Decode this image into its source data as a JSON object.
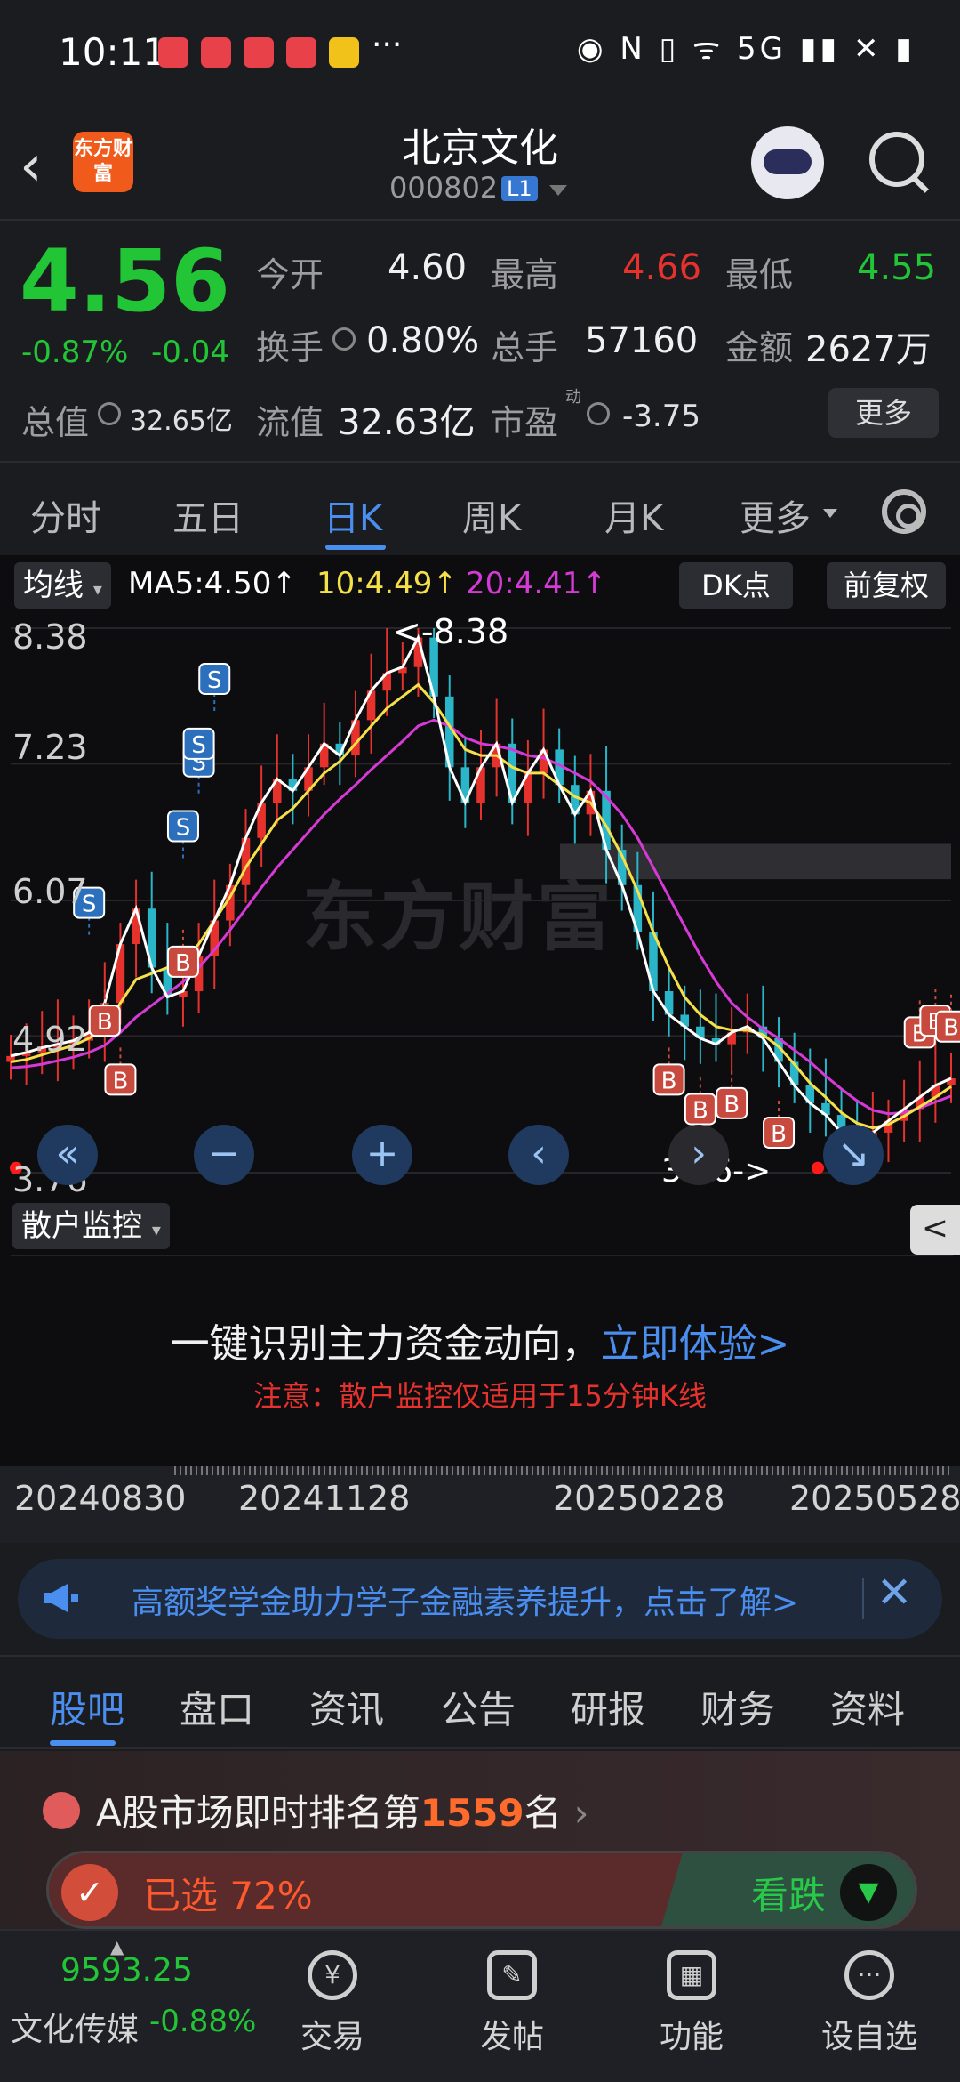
{
  "status": {
    "time": "10:11",
    "more": "···",
    "icons": "◉ N ▯ ᯤ 5G ▮▮ ✕ ▮"
  },
  "header": {
    "title": "北京文化",
    "code": "000802",
    "board_badge": "L1",
    "logo_text": "东方财富"
  },
  "quote": {
    "price": "4.56",
    "change_pct": "-0.87%",
    "change": "-0.04",
    "open_label": "今开",
    "open": "4.60",
    "high_label": "最高",
    "high": "4.66",
    "low_label": "最低",
    "low": "4.55",
    "turnover_label": "换手",
    "turnover": "0.80%",
    "volume_label": "总手",
    "volume": "57160",
    "amount_label": "金额",
    "amount": "2627万",
    "mktcap_label": "总值",
    "mktcap": "32.65亿",
    "float_label": "流值",
    "float_val": "32.63亿",
    "pe_label": "市盈",
    "pe_sup": "动",
    "pe": "-3.75",
    "more": "更多"
  },
  "ktabs": [
    "分时",
    "五日",
    "日K",
    "周K",
    "月K",
    "更多"
  ],
  "chart_toolbar": {
    "ma_label": "均线",
    "ma5": "MA5:4.50↑",
    "ma10": "10:4.49↑",
    "ma20": "20:4.41↑",
    "dk": "DK点",
    "adjust": "前复权"
  },
  "chart_labels": {
    "max_note": "<-8.38",
    "min_note": "3.76->",
    "watermark": "东方财富"
  },
  "chart_data": {
    "type": "candlestick",
    "y_ticks": [
      "8.38",
      "7.23",
      "6.07",
      "4.92",
      "3.76"
    ],
    "ylim": [
      3.76,
      8.38
    ],
    "x_ticks": [
      "20240830",
      "20241128",
      "20250228",
      "20250528"
    ],
    "max": 8.38,
    "min": 3.76,
    "series": [
      {
        "name": "MA5",
        "color": "#ffffff"
      },
      {
        "name": "MA10",
        "color": "#f5e04a"
      },
      {
        "name": "MA20",
        "color": "#d63ad6"
      }
    ],
    "close_path": [
      4.75,
      4.78,
      4.82,
      4.85,
      4.88,
      4.95,
      5.2,
      5.7,
      6.0,
      5.5,
      5.25,
      5.3,
      5.6,
      5.9,
      6.2,
      6.6,
      6.9,
      7.1,
      7.0,
      7.2,
      7.4,
      7.3,
      7.6,
      7.85,
      8.0,
      8.05,
      8.3,
      7.8,
      7.2,
      6.9,
      7.2,
      7.4,
      6.9,
      7.15,
      7.35,
      7.05,
      6.8,
      7.0,
      6.5,
      6.2,
      5.8,
      5.3,
      5.1,
      5.0,
      4.9,
      4.85,
      4.95,
      5.0,
      4.9,
      4.7,
      4.5,
      4.35,
      4.25,
      4.1,
      4.05,
      4.1,
      4.2,
      4.3,
      4.4,
      4.5,
      4.56
    ],
    "ma10_path": [
      4.7,
      4.72,
      4.76,
      4.8,
      4.84,
      4.9,
      5.0,
      5.2,
      5.4,
      5.45,
      5.5,
      5.55,
      5.7,
      5.9,
      6.1,
      6.35,
      6.55,
      6.75,
      6.85,
      7.0,
      7.15,
      7.25,
      7.4,
      7.55,
      7.7,
      7.8,
      7.9,
      7.75,
      7.55,
      7.35,
      7.3,
      7.3,
      7.2,
      7.15,
      7.15,
      7.05,
      6.95,
      6.9,
      6.7,
      6.45,
      6.15,
      5.8,
      5.5,
      5.25,
      5.1,
      5.0,
      4.97,
      4.97,
      4.93,
      4.83,
      4.68,
      4.52,
      4.4,
      4.27,
      4.18,
      4.14,
      4.17,
      4.24,
      4.32,
      4.4,
      4.49
    ],
    "ma20_path": [
      4.65,
      4.66,
      4.68,
      4.71,
      4.74,
      4.78,
      4.84,
      4.95,
      5.08,
      5.18,
      5.28,
      5.38,
      5.5,
      5.65,
      5.82,
      6.0,
      6.18,
      6.35,
      6.5,
      6.65,
      6.8,
      6.93,
      7.05,
      7.18,
      7.3,
      7.42,
      7.55,
      7.6,
      7.55,
      7.45,
      7.4,
      7.38,
      7.35,
      7.3,
      7.28,
      7.22,
      7.15,
      7.08,
      6.95,
      6.8,
      6.6,
      6.35,
      6.1,
      5.85,
      5.6,
      5.38,
      5.2,
      5.08,
      4.98,
      4.9,
      4.8,
      4.7,
      4.58,
      4.47,
      4.37,
      4.29,
      4.26,
      4.27,
      4.31,
      4.36,
      4.41
    ],
    "buy_markers": [
      {
        "i": 6,
        "p": 5.05
      },
      {
        "i": 7,
        "p": 4.55
      },
      {
        "i": 11,
        "p": 5.55
      },
      {
        "i": 42,
        "p": 4.55
      },
      {
        "i": 44,
        "p": 4.3
      },
      {
        "i": 46,
        "p": 4.35
      },
      {
        "i": 49,
        "p": 4.1
      },
      {
        "i": 58,
        "p": 4.95
      },
      {
        "i": 59,
        "p": 5.05
      },
      {
        "i": 60,
        "p": 5.0
      }
    ],
    "sell_markers": [
      {
        "i": 5,
        "p": 6.05
      },
      {
        "i": 11,
        "p": 6.7
      },
      {
        "i": 12,
        "p": 7.25
      },
      {
        "i": 12,
        "p": 7.4
      },
      {
        "i": 13,
        "p": 7.95
      }
    ]
  },
  "monitor": {
    "tag": "散户监控",
    "arrow": "<",
    "main_text": "一键识别主力资金动向，",
    "link_text": "立即体验>",
    "note": "注意：散户监控仅适用于15分钟K线"
  },
  "banner": {
    "text": "高额奖学金助力学子金融素养提升，点击了解>",
    "close": "✕"
  },
  "bottom_tabs": [
    "股吧",
    "盘口",
    "资讯",
    "公告",
    "研报",
    "财务",
    "资料"
  ],
  "rank": {
    "prefix": "A股市场即时排名第",
    "number": "1559",
    "suffix": "名",
    "selected": "已选 72%",
    "down": "看跌"
  },
  "nav": {
    "index_value": "9593.25",
    "index_name": "文化传媒",
    "index_pct": "-0.88%",
    "items": [
      "交易",
      "发帖",
      "功能",
      "设自选"
    ]
  },
  "colors": {
    "up": "#e5322d",
    "down": "#22c535",
    "accent": "#4a8eef"
  }
}
